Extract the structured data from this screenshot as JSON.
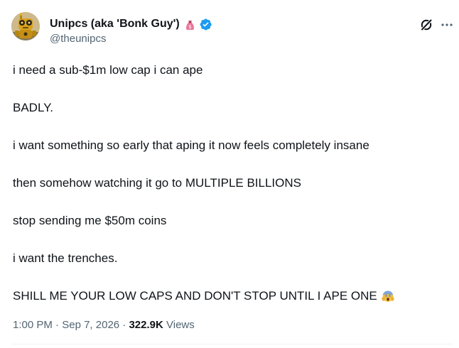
{
  "author": {
    "display_name": "Unipcs (aka 'Bonk Guy')",
    "handle": "@theunipcs",
    "badge_emoji": "money-bag-icon",
    "verified": true,
    "avatar": "robot-avatar"
  },
  "tweet": {
    "lines": [
      "i need a sub-$1m low cap i can ape",
      "BADLY.",
      "i want something so early that aping it now feels completely insane",
      "then somehow watching it go to MULTIPLE BILLIONS",
      "stop sending me $50m coins",
      "i want the trenches.",
      "SHILL ME YOUR LOW CAPS AND DON'T STOP UNTIL I APE ONE"
    ],
    "end_emoji": "screaming-face-icon"
  },
  "meta": {
    "time": "1:00 PM",
    "sep1": " · ",
    "date": "Sep 7, 2026",
    "sep2": " · ",
    "views_count": "322.9K",
    "views_label": " Views"
  },
  "colors": {
    "text": "#0f1419",
    "secondary": "#536471",
    "verified": "#1d9bf0",
    "divider": "#eff3f4"
  }
}
